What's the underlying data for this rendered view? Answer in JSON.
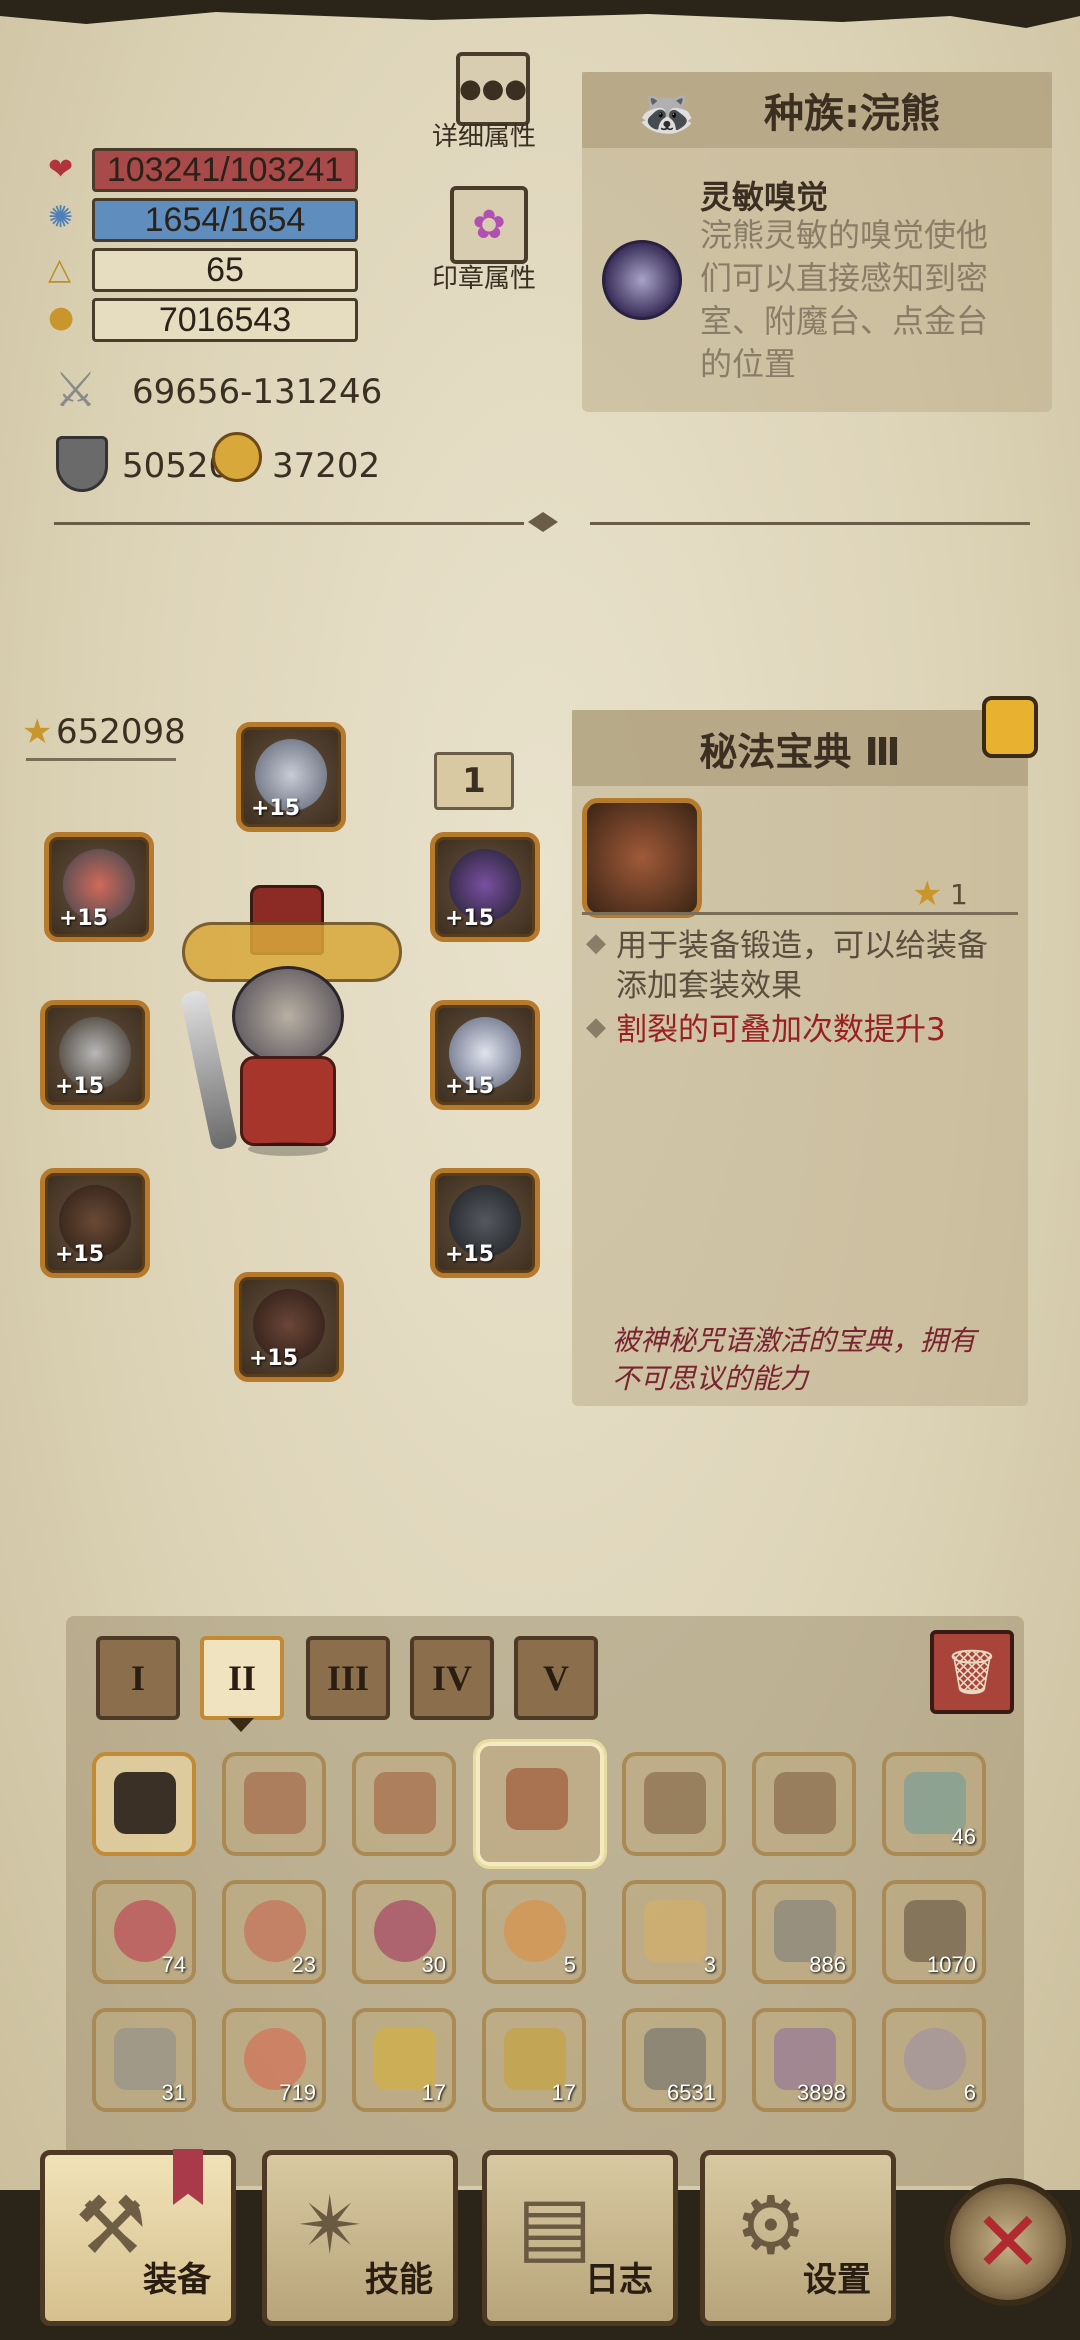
{
  "stats": {
    "hp": "103241/103241",
    "mp": "1654/1654",
    "level": "65",
    "gold": "7016543",
    "attack": "69656-131246",
    "defense": "50520",
    "magic": "37202"
  },
  "top_buttons": {
    "detail": "详细属性",
    "seal": "印章属性"
  },
  "race": {
    "title": "种族:浣熊",
    "skill_name": "灵敏嗅觉",
    "skill_desc": "浣熊灵敏的嗅觉使他们可以直接感知到密室、附魔台、点金台的位置"
  },
  "character": {
    "power": "652098",
    "set_count": "1",
    "slots": [
      "+15",
      "+15",
      "+15",
      "+15",
      "+15",
      "+15",
      "+15",
      "+15",
      "+15"
    ]
  },
  "item": {
    "name": "秘法宝典 Ⅲ",
    "star": "1",
    "desc1": "用于装备锻造，可以给装备添加套装效果",
    "desc2": "割裂的可叠加次数提升3",
    "flavor": "被神秘咒语激活的宝典，拥有不可思议的能力"
  },
  "tiers": [
    "I",
    "II",
    "III",
    "IV",
    "V"
  ],
  "inventory": {
    "row1": [
      "",
      "",
      "",
      "",
      "",
      "",
      "46"
    ],
    "row2": [
      "74",
      "23",
      "30",
      "5",
      "3",
      "886",
      "1070"
    ],
    "row3": [
      "31",
      "719",
      "17",
      "17",
      "6531",
      "3898",
      "6"
    ]
  },
  "nav": {
    "equip": "装备",
    "skill": "技能",
    "log": "日志",
    "settings": "设置"
  },
  "colors": {
    "hp_bar": "#a84a4a",
    "mp_bar": "#5e8dbe",
    "accent": "#c28a34",
    "red_text": "#9a2020"
  }
}
